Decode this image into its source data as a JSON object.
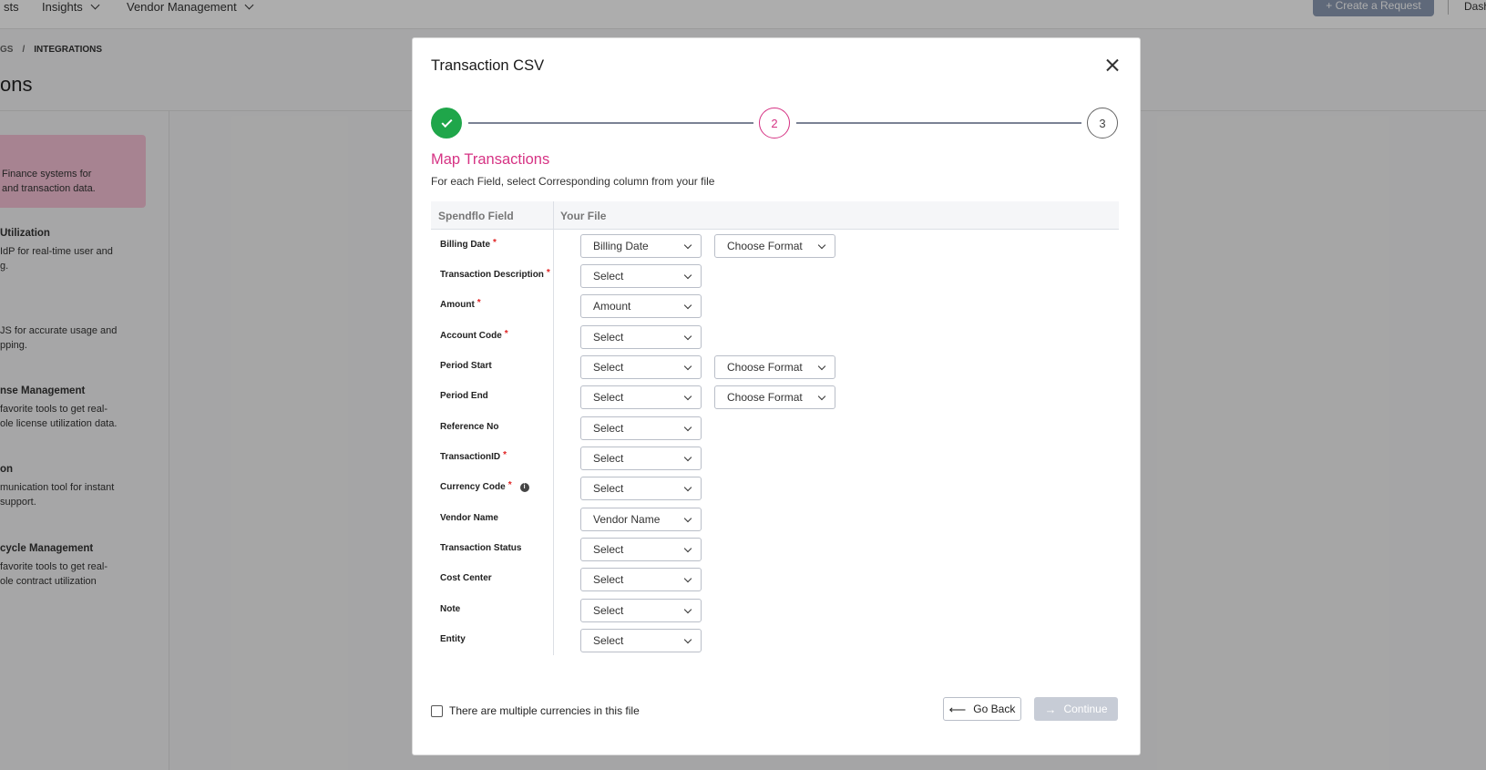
{
  "topnav": {
    "items": [
      {
        "label": "sts"
      },
      {
        "label": "Insights"
      },
      {
        "label": "Vendor Management"
      }
    ],
    "create_label": "+ Create a Request",
    "right_label": "Dash"
  },
  "breadcrumb": {
    "parent": "GS",
    "separator": "/",
    "current": "INTEGRATIONS"
  },
  "background": {
    "page_title": "ons",
    "card_line1": "Finance systems for",
    "card_line2": "and transaction data.",
    "items": [
      {
        "heading": "Utilization",
        "line1": "IdP for real-time user and",
        "line2": "g."
      },
      {
        "heading": "",
        "line1": "JS for accurate usage and",
        "line2": "pping."
      },
      {
        "heading": "nse Management",
        "line1": "favorite tools to get real-",
        "line2": "ole license utilization data."
      },
      {
        "heading": "on",
        "line1": "munication tool for instant",
        "line2": "support."
      },
      {
        "heading": "cycle Management",
        "line1": "favorite tools to get real-",
        "line2": "ole contract utilization"
      }
    ]
  },
  "modal": {
    "title": "Transaction CSV",
    "steps": {
      "step2": "2",
      "step3": "3"
    },
    "section_title": "Map Transactions",
    "section_sub": "For each Field, select Corresponding column from your file",
    "columns": {
      "field": "Spendflo Field",
      "file": "Your File"
    },
    "rows": [
      {
        "field": "Billing Date",
        "value": "Billing Date",
        "format": "Choose Format"
      },
      {
        "field": "Transaction Description",
        "value": "Select"
      },
      {
        "field": "Amount",
        "value": "Amount"
      },
      {
        "field": "Account Code",
        "value": "Select"
      },
      {
        "field": "Period Start",
        "value": "Select",
        "format": "Choose Format"
      },
      {
        "field": "Period End",
        "value": "Select",
        "format": "Choose Format"
      },
      {
        "field": "Reference No",
        "value": "Select"
      },
      {
        "field": "TransactionID",
        "value": "Select"
      },
      {
        "field": "Currency Code",
        "value": "Select"
      },
      {
        "field": "Vendor Name",
        "value": "Vendor Name"
      },
      {
        "field": "Transaction Status",
        "value": "Select"
      },
      {
        "field": "Cost Center",
        "value": "Select"
      },
      {
        "field": "Note",
        "value": "Select"
      },
      {
        "field": "Entity",
        "value": "Select"
      }
    ],
    "required_mark": "*",
    "info_glyph": "i",
    "multi_currency_label": "There are multiple currencies in this file",
    "back_label": "Go Back",
    "continue_label": "Continue"
  },
  "colors": {
    "accent": "#d63384",
    "success": "#1fa64a",
    "disabled": "#c7ccd6"
  }
}
